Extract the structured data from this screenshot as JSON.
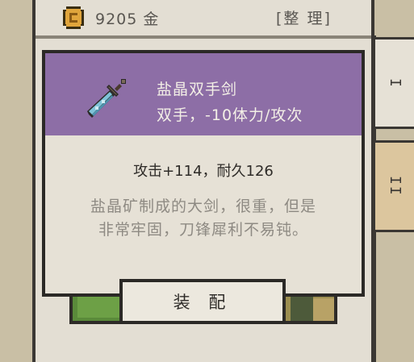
{
  "currency": {
    "amount": "9205",
    "unit": "金",
    "icon": "gold-coin-icon"
  },
  "toolbar": {
    "sort_label": "[整 理]"
  },
  "tabs": [
    {
      "label": "I"
    },
    {
      "label": "II"
    }
  ],
  "item": {
    "icon": "sword-icon",
    "name": "盐晶双手剑",
    "type_line": "双手，-10体力/攻次",
    "stats": "攻击+114，耐久126",
    "description_lines": [
      "盐晶矿制成的大剑，很重，但是",
      "非常牢固，刀锋犀利不易钝。"
    ]
  },
  "actions": {
    "equip_label": "装 配"
  },
  "colors": {
    "header_purple": "#8d6ea6",
    "panel_bg": "#e6e1d6",
    "border": "#2b2926",
    "tab_active": "#dcc69e"
  }
}
